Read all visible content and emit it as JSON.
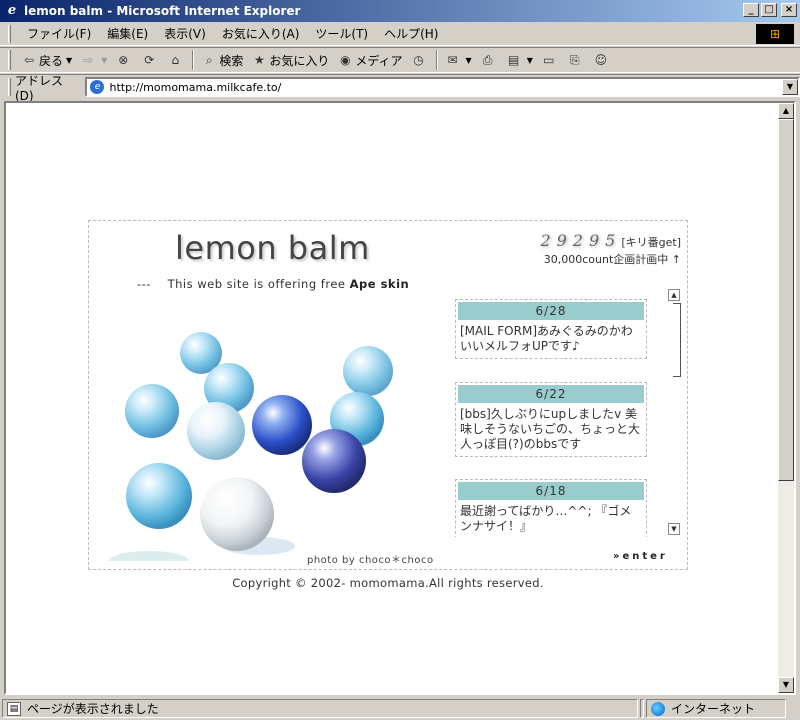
{
  "window": {
    "title": "lemon balm - Microsoft Internet Explorer",
    "minimize": "_",
    "maximize": "□",
    "close": "×"
  },
  "menu": {
    "items": [
      "ファイル(F)",
      "編集(E)",
      "表示(V)",
      "お気に入り(A)",
      "ツール(T)",
      "ヘルプ(H)"
    ]
  },
  "toolbar": {
    "back": "戻る",
    "search": "検索",
    "favorites": "お気に入り",
    "media": "メディア"
  },
  "address": {
    "label": "アドレス(D)",
    "url": "http://momomama.milkcafe.to/"
  },
  "page": {
    "title": "lemon balm",
    "tagline_prefix": "---    This web site is offering free ",
    "tagline_bold": "Ape skin",
    "counter_digits": "29295",
    "counter_suffix": "[キリ番get]",
    "counter_line2": "30,000count企画計画中 ↑",
    "news": [
      {
        "date": "6/28",
        "text": "[MAIL FORM]あみぐるみのかわいいメルフォUPです♪"
      },
      {
        "date": "6/22",
        "text": "[bbs]久しぶりにupしましたv 美味しそうないちごの、ちょっと大人っぽ目(?)のbbsです"
      },
      {
        "date": "6/18",
        "text": "最近謝ってばかり…^^; 『ゴメンナサイ！』"
      }
    ],
    "photo_credit": "photo by choco＊choco",
    "enter": "»enter",
    "copyright": "Copyright © 2002- momomama.All rights reserved."
  },
  "status": {
    "text": "ページが表示されました",
    "zone": "インターネット"
  },
  "colors": {
    "news_header": "#99cccc",
    "title_bar": "#0a246a"
  }
}
